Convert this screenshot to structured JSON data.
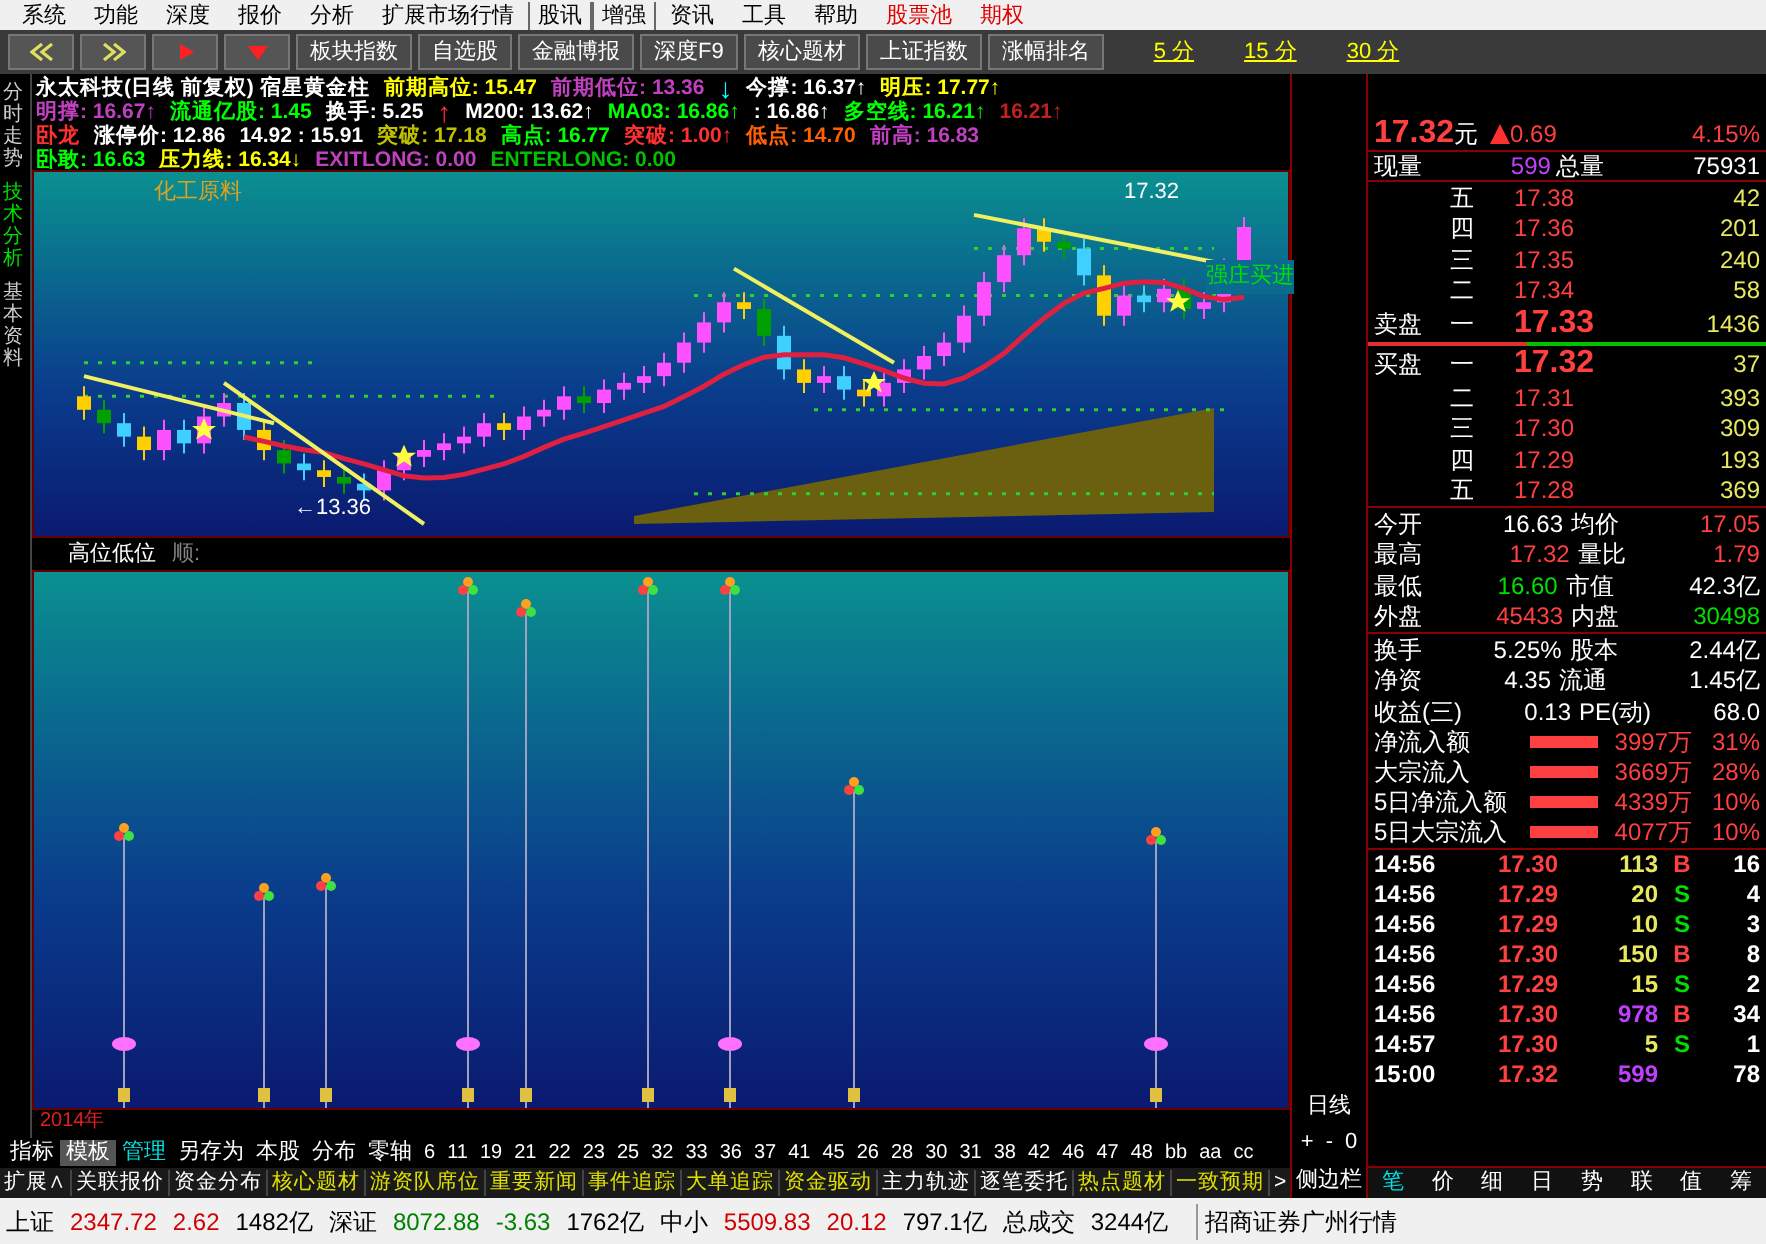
{
  "menu_bar": {
    "items": [
      {
        "label": "系统",
        "kind": "normal"
      },
      {
        "label": "功能",
        "kind": "normal"
      },
      {
        "label": "深度",
        "kind": "normal"
      },
      {
        "label": "报价",
        "kind": "normal"
      },
      {
        "label": "分析",
        "kind": "normal"
      },
      {
        "label": "扩展市场行情",
        "kind": "normal"
      },
      {
        "label": "股讯",
        "kind": "boxed"
      },
      {
        "label": "增强",
        "kind": "boxed"
      },
      {
        "label": "资讯",
        "kind": "normal"
      },
      {
        "label": "工具",
        "kind": "normal"
      },
      {
        "label": "帮助",
        "kind": "normal"
      },
      {
        "label": "股票池",
        "kind": "alert"
      },
      {
        "label": "期权",
        "kind": "alert"
      }
    ]
  },
  "toolbar": {
    "nav_buttons": [
      {
        "kind": "back"
      },
      {
        "kind": "forward"
      },
      {
        "kind": "play"
      },
      {
        "kind": "down"
      }
    ],
    "buttons": [
      "板块指数",
      "自选股",
      "金融博报",
      "深度F9",
      "核心题材",
      "上证指数",
      "涨幅排名"
    ],
    "periods": [
      "5 分",
      "15 分",
      "30 分"
    ]
  },
  "side_tabs": [
    {
      "label": "分时走势",
      "selected": false
    },
    {
      "label": "技术分析",
      "selected": true
    },
    {
      "label": "基本资料",
      "selected": false
    }
  ],
  "indicator_header": {
    "lines": [
      [
        {
          "text": "永太科技(日线 前复权) 宿星黄金柱",
          "color": "#ffffff"
        },
        {
          "text": "前期高位: 15.47",
          "color": "#ffff00"
        },
        {
          "text": "前期低位: 13.36",
          "color": "#c040c0"
        },
        {
          "text": "↓",
          "color": "#00ffff"
        },
        {
          "text": "今撑: 16.37↑",
          "color": "#ffffff"
        },
        {
          "text": "明压: 17.77↑",
          "color": "#ffff00"
        }
      ],
      [
        {
          "text": "明撑: 16.67↑",
          "color": "#c040c0"
        },
        {
          "text": "流通亿股: 1.45",
          "color": "#00ff00"
        },
        {
          "text": "换手: 5.25",
          "color": "#ffffff"
        },
        {
          "text": "↑",
          "color": "#ff3030"
        },
        {
          "text": "M200: 13.62↑",
          "color": "#ffffff"
        },
        {
          "text": "MA03: 16.86↑",
          "color": "#00ff00"
        },
        {
          "text": ": 16.86↑",
          "color": "#ffffff"
        },
        {
          "text": "多空线: 16.21↑",
          "color": "#00ff00"
        },
        {
          "text": "16.21↑",
          "color": "#c02020"
        }
      ],
      [
        {
          "text": "卧龙",
          "color": "#ff3030"
        },
        {
          "text": "涨停价: 12.86",
          "color": "#ffffff"
        },
        {
          "text": "14.92 : 15.91",
          "color": "#ffffff"
        },
        {
          "text": "突破: 17.18",
          "color": "#c0c000"
        },
        {
          "text": "高点: 16.77",
          "color": "#00ff00"
        },
        {
          "text": "突破: 1.00↑",
          "color": "#ff3030"
        },
        {
          "text": "低点: 14.70",
          "color": "#ff6000"
        },
        {
          "text": "前高: 16.83",
          "color": "#c040c0"
        }
      ],
      [
        {
          "text": "卧敢: 16.63",
          "color": "#00ff00"
        },
        {
          "text": "压力线: 16.34↓",
          "color": "#ffff00"
        },
        {
          "text": "EXITLONG: 0.00",
          "color": "#c040c0"
        },
        {
          "text": "ENTERLONG: 0.00",
          "color": "#00c000"
        }
      ]
    ]
  },
  "price_chart": {
    "sector_label": "化工原料",
    "high_label": "17.32",
    "low_label": "←13.36",
    "signal_label": "强庄买进"
  },
  "lower_panel": {
    "title": "高位低位",
    "subtitle": "顺:",
    "year_label": "2014年"
  },
  "template_bar": {
    "tabs": [
      {
        "label": "指标",
        "selected": false,
        "kind": "plain"
      },
      {
        "label": "模板",
        "selected": true,
        "kind": "plain"
      },
      {
        "label": "管理",
        "selected": false,
        "kind": "accent"
      },
      {
        "label": "另存为",
        "selected": false,
        "kind": "plain"
      },
      {
        "label": "本股",
        "selected": false,
        "kind": "plain"
      },
      {
        "label": "分布",
        "selected": false,
        "kind": "plain"
      },
      {
        "label": "零轴",
        "selected": false,
        "kind": "plain"
      }
    ],
    "numbers": [
      "6",
      "11",
      "19",
      "21",
      "22",
      "23",
      "25",
      "32",
      "33",
      "36",
      "37",
      "41",
      "45",
      "26",
      "28",
      "30",
      "31",
      "38",
      "42",
      "46",
      "47",
      "48",
      "bb",
      "aa",
      "cc"
    ]
  },
  "ext_bar": {
    "items": [
      {
        "label": "扩展∧",
        "highlight": false
      },
      {
        "label": "关联报价",
        "highlight": false
      },
      {
        "label": "资金分布",
        "highlight": false
      },
      {
        "label": "核心题材",
        "highlight": true
      },
      {
        "label": "游资队席位",
        "highlight": true
      },
      {
        "label": "重要新闻",
        "highlight": true
      },
      {
        "label": "事件追踪",
        "highlight": true
      },
      {
        "label": "大单追踪",
        "highlight": true
      },
      {
        "label": "资金驱动",
        "highlight": true
      },
      {
        "label": "主力轨迹",
        "highlight": false
      },
      {
        "label": "逐笔委托",
        "highlight": false
      },
      {
        "label": "热点题材",
        "highlight": true
      },
      {
        "label": "一致预期",
        "highlight": true
      }
    ],
    "more": ">"
  },
  "axis_column": {
    "period_label": "日线",
    "zoom_controls": [
      "+",
      "-",
      "0"
    ],
    "sidebar_button": "侧边栏"
  },
  "quote": {
    "price": "17.32",
    "unit": "元",
    "change": "0.69",
    "change_pct": "4.15%",
    "volume_row": {
      "label": "现量",
      "value": "599",
      "total_label": "总量",
      "total": "75931"
    },
    "asks": [
      {
        "level": "五",
        "price": "17.38",
        "volume": "42"
      },
      {
        "level": "四",
        "price": "17.36",
        "volume": "201"
      },
      {
        "level": "三",
        "price": "17.35",
        "volume": "240"
      },
      {
        "level": "二",
        "price": "17.34",
        "volume": "58"
      },
      {
        "side": "卖盘",
        "level": "一",
        "price": "17.33",
        "volume": "1436"
      }
    ],
    "bids": [
      {
        "side": "买盘",
        "level": "一",
        "price": "17.32",
        "volume": "37"
      },
      {
        "level": "二",
        "price": "17.31",
        "volume": "393"
      },
      {
        "level": "三",
        "price": "17.30",
        "volume": "309"
      },
      {
        "level": "四",
        "price": "17.29",
        "volume": "193"
      },
      {
        "level": "五",
        "price": "17.28",
        "volume": "369"
      }
    ],
    "stats": [
      [
        {
          "label": "今开",
          "value": "16.63",
          "color": "#ffffff"
        },
        {
          "label": "均价",
          "value": "17.05",
          "color": "#ff4040"
        }
      ],
      [
        {
          "label": "最高",
          "value": "17.32",
          "color": "#ff4040"
        },
        {
          "label": "量比",
          "value": "1.79",
          "color": "#ff4040"
        }
      ],
      [
        {
          "label": "最低",
          "value": "16.60",
          "color": "#00e000"
        },
        {
          "label": "市值",
          "value": "42.3亿",
          "color": "#ffffff"
        }
      ],
      [
        {
          "label": "外盘",
          "value": "45433",
          "color": "#ff4040"
        },
        {
          "label": "内盘",
          "value": "30498",
          "color": "#00e000"
        }
      ]
    ],
    "fundamentals": [
      [
        {
          "label": "换手",
          "value": "5.25%"
        },
        {
          "label": "股本",
          "value": "2.44亿"
        }
      ],
      [
        {
          "label": "净资",
          "value": "4.35"
        },
        {
          "label": "流通",
          "value": "1.45亿"
        }
      ],
      [
        {
          "label": "收益(三)",
          "value": "0.13"
        },
        {
          "label": "PE(动)",
          "value": "68.0"
        }
      ]
    ],
    "flows": [
      {
        "label": "净流入额",
        "amount": "3997万",
        "pct": "31%"
      },
      {
        "label": "大宗流入",
        "amount": "3669万",
        "pct": "28%"
      },
      {
        "label": "5日净流入额",
        "amount": "4339万",
        "pct": "10%"
      },
      {
        "label": "5日大宗流入",
        "amount": "4077万",
        "pct": "10%"
      }
    ],
    "ticks": [
      {
        "time": "14:56",
        "price": "17.30",
        "volume": "113",
        "large": false,
        "side": "B",
        "kind": "buy",
        "count": "16"
      },
      {
        "time": "14:56",
        "price": "17.29",
        "volume": "20",
        "large": false,
        "side": "S",
        "kind": "sell",
        "count": "4"
      },
      {
        "time": "14:56",
        "price": "17.29",
        "volume": "10",
        "large": false,
        "side": "S",
        "kind": "sell",
        "count": "3"
      },
      {
        "time": "14:56",
        "price": "17.30",
        "volume": "150",
        "large": false,
        "side": "B",
        "kind": "buy",
        "count": "8"
      },
      {
        "time": "14:56",
        "price": "17.29",
        "volume": "15",
        "large": false,
        "side": "S",
        "kind": "sell",
        "count": "2"
      },
      {
        "time": "14:56",
        "price": "17.30",
        "volume": "978",
        "large": true,
        "side": "B",
        "kind": "buy",
        "count": "34"
      },
      {
        "time": "14:57",
        "price": "17.30",
        "volume": "5",
        "large": false,
        "side": "S",
        "kind": "sell",
        "count": "1"
      },
      {
        "time": "15:00",
        "price": "17.32",
        "volume": "599",
        "large": true,
        "kind": "none",
        "count": "78"
      }
    ],
    "tabs": [
      {
        "label": "笔",
        "selected": true
      },
      {
        "label": "价",
        "selected": false
      },
      {
        "label": "细",
        "selected": false
      },
      {
        "label": "日",
        "selected": false
      },
      {
        "label": "势",
        "selected": false
      },
      {
        "label": "联",
        "selected": false
      },
      {
        "label": "值",
        "selected": false
      },
      {
        "label": "筹",
        "selected": false
      }
    ]
  },
  "status_bar": {
    "items": [
      {
        "text": "上证",
        "color": "#000000"
      },
      {
        "text": "2347.72",
        "color": "#d00000"
      },
      {
        "text": "2.62",
        "color": "#d00000"
      },
      {
        "text": "1482亿",
        "color": "#000000"
      },
      {
        "text": "深证",
        "color": "#000000"
      },
      {
        "text": "8072.88",
        "color": "#008000"
      },
      {
        "text": "-3.63",
        "color": "#008000"
      },
      {
        "text": "1762亿",
        "color": "#000000"
      },
      {
        "text": "中小",
        "color": "#000000"
      },
      {
        "text": "5509.83",
        "color": "#d00000"
      },
      {
        "text": "20.12",
        "color": "#d00000"
      },
      {
        "text": "797.1亿",
        "color": "#000000"
      },
      {
        "text": "总成交",
        "color": "#000000"
      },
      {
        "text": "3244亿",
        "color": "#000000"
      }
    ],
    "broker": "招商证券广州行情"
  }
}
